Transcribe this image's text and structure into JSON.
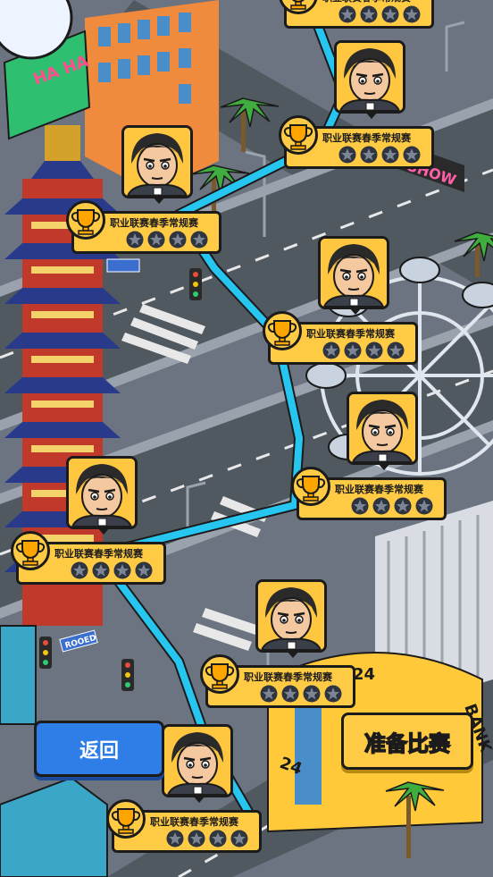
{
  "map": {
    "levels": [
      {
        "id": "level-1",
        "title": "职业联赛春季常规赛",
        "stars": 4
      },
      {
        "id": "level-2",
        "title": "职业联赛春季常规赛",
        "stars": 4
      },
      {
        "id": "level-3",
        "title": "职业联赛春季常规赛",
        "stars": 4
      },
      {
        "id": "level-4",
        "title": "职业联赛春季常规赛",
        "stars": 4
      },
      {
        "id": "level-5",
        "title": "职业联赛春季常规赛",
        "stars": 4
      },
      {
        "id": "level-6",
        "title": "职业联赛春季常规赛",
        "stars": 4
      },
      {
        "id": "level-7",
        "title": "职业联赛春季常规赛",
        "stars": 4
      },
      {
        "id": "level-8",
        "title": "职业联赛春季常规赛",
        "stars": 4
      }
    ]
  },
  "buttons": {
    "back_label": "返回",
    "ready_label": "准备比赛"
  },
  "signs": {
    "road": "ROOED",
    "bank": "BANK",
    "number": "24",
    "ha": "HA HA",
    "show": "SHOW"
  },
  "colors": {
    "path": "#26c6f0",
    "plate": "#ffcb45",
    "back": "#2f7de6"
  }
}
